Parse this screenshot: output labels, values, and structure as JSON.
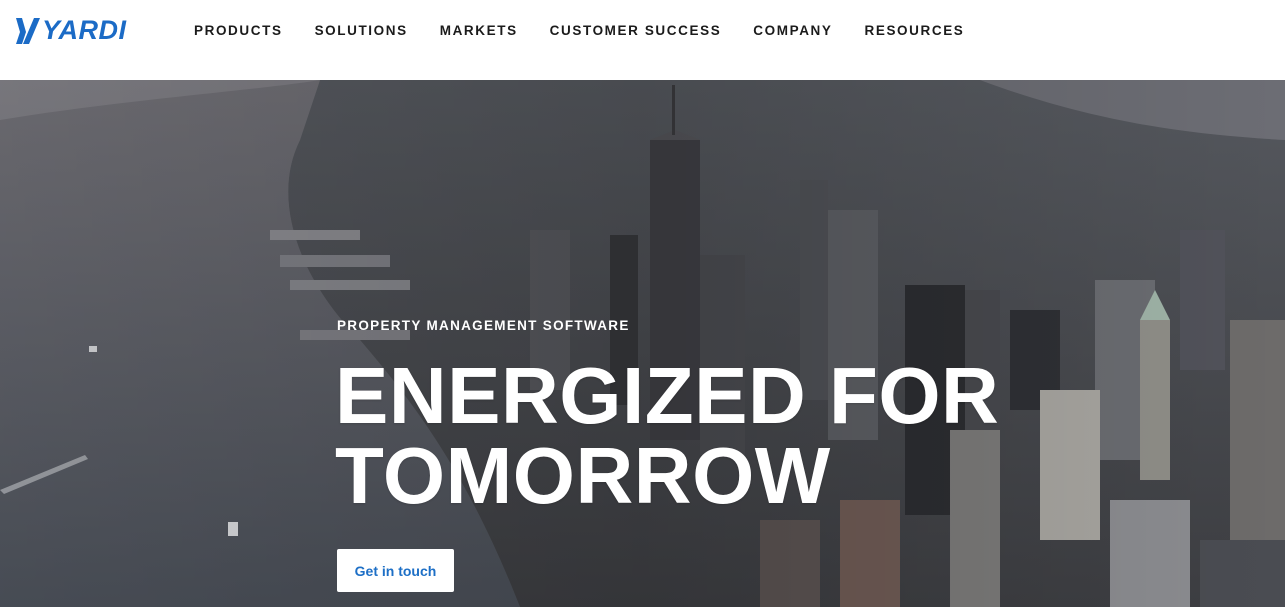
{
  "header": {
    "logo_text": "YARDI",
    "nav": [
      {
        "label": "PRODUCTS"
      },
      {
        "label": "SOLUTIONS"
      },
      {
        "label": "MARKETS"
      },
      {
        "label": "CUSTOMER SUCCESS"
      },
      {
        "label": "COMPANY"
      },
      {
        "label": "RESOURCES"
      }
    ]
  },
  "hero": {
    "eyebrow": "PROPERTY MANAGEMENT SOFTWARE",
    "headline_line1": "ENERGIZED FOR",
    "headline_line2": "TOMORROW",
    "cta_label": "Get in touch"
  },
  "colors": {
    "brand_blue": "#1b6bc6",
    "nav_text": "#1b1b1b",
    "hero_text": "#ffffff",
    "cta_background": "#ffffff",
    "cta_text": "#1d6fc6"
  },
  "icons": {
    "logo_mark": "yardi-logo-mark-icon"
  }
}
